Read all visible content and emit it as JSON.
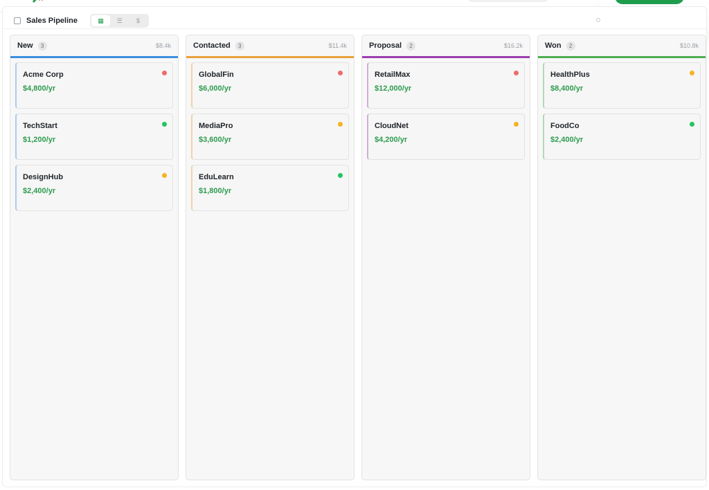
{
  "board": {
    "title": "Sales Pipeline",
    "views": [
      {
        "name": "board-view",
        "glyph": "▦",
        "active": true
      },
      {
        "name": "list-view",
        "glyph": "☰",
        "active": false
      },
      {
        "name": "value-view",
        "glyph": "$",
        "active": false
      }
    ]
  },
  "colors": {
    "accent": "#1e9e4d",
    "money": "#2e9b4f",
    "priority_high": "#ef6b6b",
    "priority_medium": "#f5b323",
    "priority_low": "#22c55e"
  },
  "columns": [
    {
      "name": "New",
      "count": "3",
      "total": "$8.4k",
      "color": "#3b8fe0",
      "cards": [
        {
          "name": "Acme Corp",
          "value": "$4,800/yr",
          "priority": "high"
        },
        {
          "name": "TechStart",
          "value": "$1,200/yr",
          "priority": "low"
        },
        {
          "name": "DesignHub",
          "value": "$2,400/yr",
          "priority": "medium"
        }
      ]
    },
    {
      "name": "Contacted",
      "count": "3",
      "total": "$11.4k",
      "color": "#e9a23b",
      "cards": [
        {
          "name": "GlobalFin",
          "value": "$6,000/yr",
          "priority": "high"
        },
        {
          "name": "MediaPro",
          "value": "$3,600/yr",
          "priority": "medium"
        },
        {
          "name": "EduLearn",
          "value": "$1,800/yr",
          "priority": "low"
        }
      ]
    },
    {
      "name": "Proposal",
      "count": "2",
      "total": "$16.2k",
      "color": "#9b3fb0",
      "cards": [
        {
          "name": "RetailMax",
          "value": "$12,000/yr",
          "priority": "high"
        },
        {
          "name": "CloudNet",
          "value": "$4,200/yr",
          "priority": "medium"
        }
      ]
    },
    {
      "name": "Won",
      "count": "2",
      "total": "$10.8k",
      "color": "#4caf50",
      "cards": [
        {
          "name": "HealthPlus",
          "value": "$8,400/yr",
          "priority": "medium"
        },
        {
          "name": "FoodCo",
          "value": "$2,400/yr",
          "priority": "low"
        }
      ]
    }
  ]
}
